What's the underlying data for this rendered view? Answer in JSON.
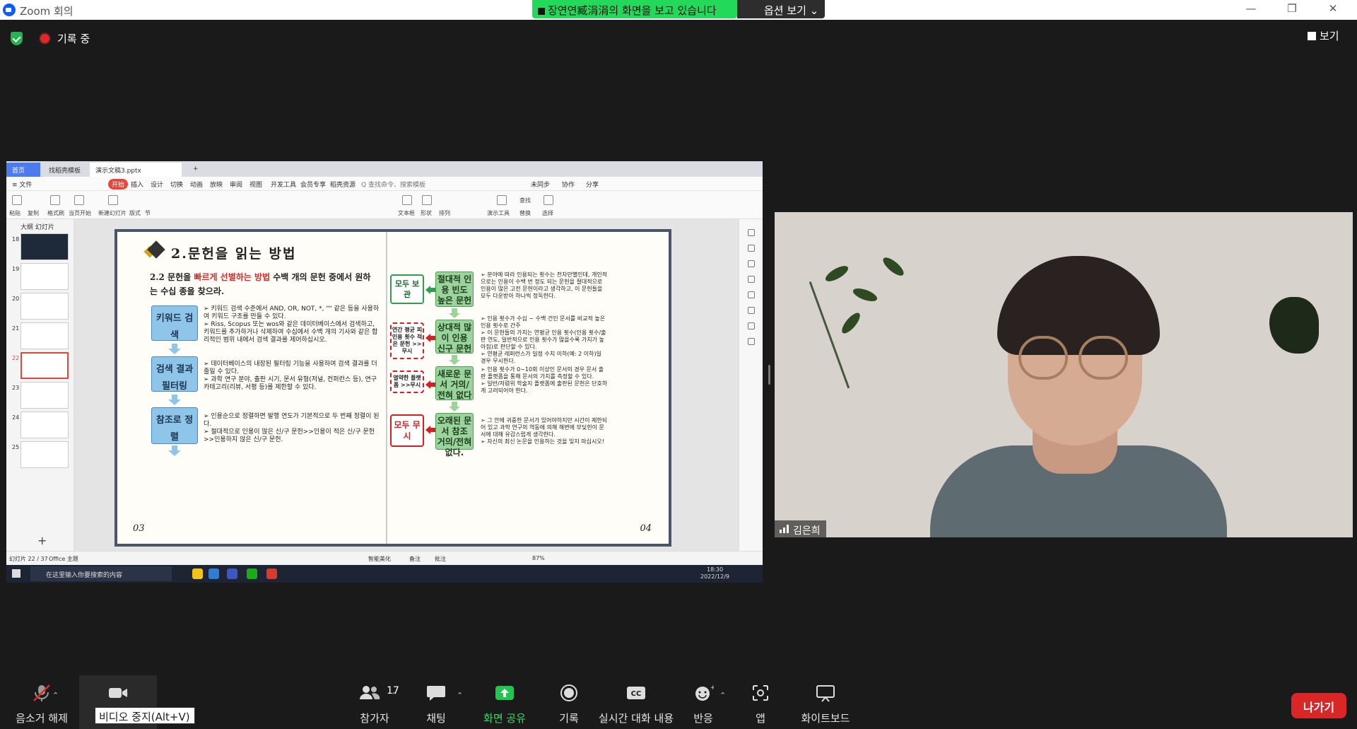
{
  "window": {
    "title": "Zoom 회의",
    "share_banner": "장연연臧涓涓의 화면을 보고 있습니다",
    "options_label": "옵션 보기",
    "minimize": "—",
    "restore": "❐",
    "close": "✕"
  },
  "meeting": {
    "recording_label": "기록 중",
    "view_label": "보기"
  },
  "wps": {
    "tab_home": "首页",
    "tab_template": "找稻壳模板",
    "tab_file": "演示文稿3.pptx",
    "menu": [
      "≡ 文件",
      "开始",
      "插入",
      "设计",
      "切换",
      "动画",
      "放映",
      "审阅",
      "视图",
      "开发工具",
      "会员专享",
      "稻壳资源",
      "Q 查找命令、搜索模板"
    ],
    "menu_right": [
      "未同步",
      "协作",
      "分享"
    ],
    "ribbon": [
      "粘贴",
      "复制",
      "格式刷",
      "当页开始",
      "新建幻灯片",
      "版式",
      "节",
      "文本框",
      "形状",
      "排列",
      "演示工具",
      "查找",
      "替换",
      "选择"
    ],
    "thumb_tabs": "大纲   幻灯片",
    "slide_numbers": [
      "18",
      "19",
      "20",
      "21",
      "22",
      "23",
      "24",
      "25"
    ],
    "status_left": "幻灯片 22 / 37",
    "status_theme": "Office 主题",
    "status_right": [
      "智能美化",
      "备注",
      "批注",
      "87%"
    ],
    "taskbar_search": "在这里输入你要搜索的内容",
    "clock_time": "18:30",
    "clock_date": "2022/12/9"
  },
  "slide": {
    "title": "2.문헌을 읽는 방법",
    "lead_prefix": "2.2 문헌을 ",
    "lead_highlight": "빠르게 선별하는 방법",
    "lead_suffix": " 수백 개의 문헌 중에서 원하는 수십 종을 찾으라.",
    "steps": [
      {
        "label": "키워드 검색",
        "bullets": [
          "➢ 키워드 검색 수준에서 AND, OR, NOT, *, \"\" 같은 등을 사용하여 키워드 구조를 만들 수 있다.",
          "➢ Riss, Scopus 또는 wos와 같은 데이터베이스에서 검색하고, 키워드를 추가하거나 삭제하여 수십에서 수백 개의 기사와 같은 합리적인 범위 내에서 검색 결과를 제어하십시오."
        ]
      },
      {
        "label": "검색 결과 필터링",
        "bullets": [
          "➢ 데이터베이스의 내장된 필터링 기능을 사용하여 검색 결과를 더 줄일 수 있다.",
          "➢ 과학 연구 분야, 출판 시기, 문서 유형(저널, 컨퍼런스 등), 연구 카테고리(리뷰, 서평 등)를 제한할 수 있다."
        ]
      },
      {
        "label": "참조로 정렬",
        "bullets": [
          "➢ 인용순으로 정렬하면 발행 연도가 기본적으로 두 번째 정렬이 된다.",
          "➢ 절대적으로 인용이 많은 신/구 문헌>>인용이 적은 신/구 문헌>>인용하지 않은 신/구 문헌."
        ]
      }
    ],
    "page_left": "03",
    "page_right": "04",
    "flow": [
      {
        "side": "모두 보관",
        "side_type": "solid",
        "center": "절대적 인용 빈도 높은 문헌",
        "text": [
          "➢ 분야에 따라 인용되는 횟수는 천차만별인데, 개인적으로는 인용이 수백 번 정도 되는 문헌을 절대적으로 인용이 많은 고전 문헌이라고 생각하고, 이 문헌들을 모두 다운받아 하나씩 정독한다."
        ]
      },
      {
        "side": "연간 평균 피인용 횟수 적은 문헌 >>무시",
        "side_type": "dashed",
        "center": "상대적 많이 인용 신구 문헌",
        "text": [
          "➢ 인용 횟수가 수십 ~ 수백 건인 문서를 비교적 높은 인용 횟수로 간주",
          "➢ 이 문헌들의 가치는 연평균 인용 횟수(인용 횟수/출판 연도, 일반적으로 인용 횟수가 많을수록 가치가 높아짐)로 판단할 수 있다.",
          "➢ 연평균 레퍼런스가 일정 수치 이하(예: 2 이하)일 경우 무시한다."
        ]
      },
      {
        "side": "열약한 플랫폼 >>무시",
        "side_type": "dashed",
        "center": "새로운 문서 거의/전혀 없다",
        "text": [
          "➢ 인용 횟수가 0~10회 이상인 문서의 경우 문서 출판 플랫폼을 통해 문서의 가치를 측정할 수 있다.",
          "➢ 일반/저렴위 학술지 플랫폼에 출판된 문헌은 단호하게 고려되어야 한다."
        ]
      },
      {
        "side": "모두 무시",
        "side_type": "red",
        "center": "오래된 문서 참조 거의/전혀 없다.",
        "text": [
          "➢ 그 안에 귀중한 문서가 있어야하지만 시간이 제한되어 있고 과학 연구의 역동에 의해 해변에 부딪힌이 문서에 대해 유감스럽게 생각한다.",
          "➢ 자신의 최신 논문을 인용하는 것을 잊지 마십시오!"
        ]
      }
    ]
  },
  "participant": {
    "name": "김은희"
  },
  "toolbar": {
    "mute": "음소거 해제",
    "video": "비디오 중지",
    "participants": "참가자",
    "participants_count": "17",
    "chat": "채팅",
    "share": "화면 공유",
    "record": "기록",
    "cc": "실시간 대화 내용",
    "reactions": "반응",
    "apps": "앱",
    "whiteboard": "화이트보드",
    "leave": "나가기",
    "video_tooltip": "비디오 중지(Alt+V)",
    "cc_icon": "CC"
  },
  "colors": {
    "share_green": "#23d959",
    "leave_red": "#d92626",
    "slide_step_blue": "#8ec5e8",
    "slide_flow_green": "#9ad39b",
    "slide_red": "#d42020"
  }
}
